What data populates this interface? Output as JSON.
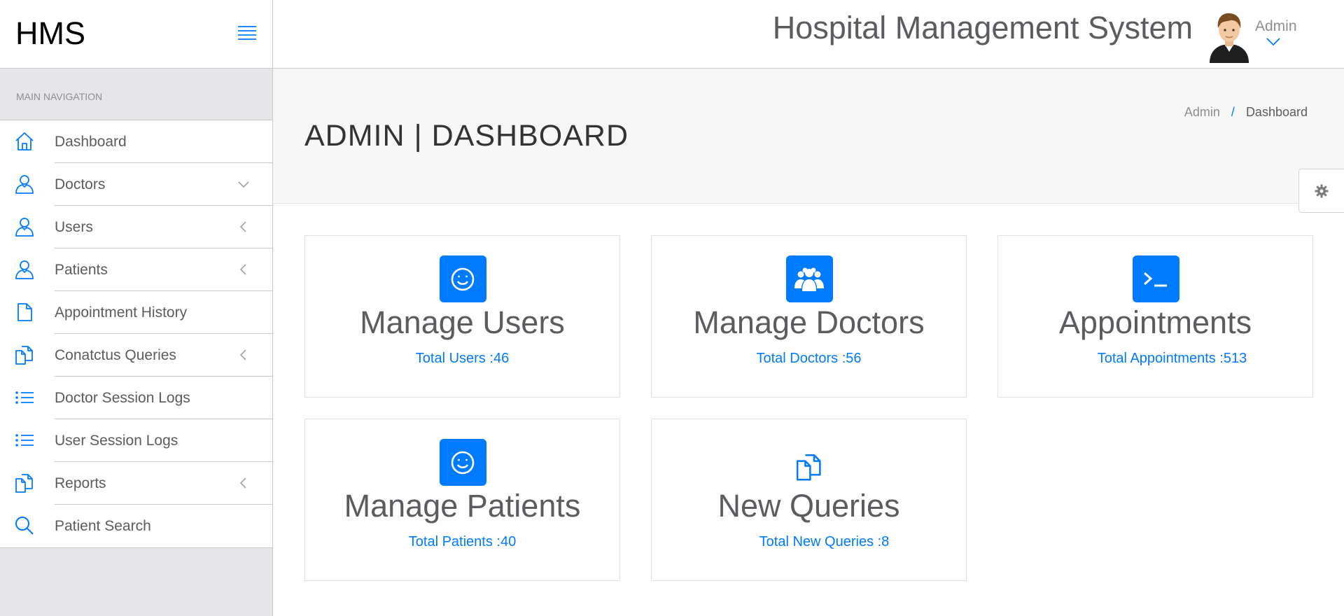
{
  "brand": "HMS",
  "nav_title": "MAIN NAVIGATION",
  "nav_items": [
    {
      "label": "Dashboard",
      "icon": "home-icon",
      "caret": ""
    },
    {
      "label": "Doctors",
      "icon": "user-icon",
      "caret": "chevron-down-icon"
    },
    {
      "label": "Users",
      "icon": "user-icon",
      "caret": "chevron-left-icon"
    },
    {
      "label": "Patients",
      "icon": "user-icon",
      "caret": "chevron-left-icon"
    },
    {
      "label": "Appointment History",
      "icon": "file-icon",
      "caret": ""
    },
    {
      "label": "Conatctus Queries",
      "icon": "files-icon",
      "caret": "chevron-left-icon"
    },
    {
      "label": "Doctor Session Logs",
      "icon": "list-icon",
      "caret": ""
    },
    {
      "label": "User Session Logs",
      "icon": "list-icon",
      "caret": ""
    },
    {
      "label": "Reports",
      "icon": "files-icon",
      "caret": "chevron-left-icon"
    },
    {
      "label": "Patient Search",
      "icon": "search-icon",
      "caret": ""
    }
  ],
  "header": {
    "title": "Hospital Management System",
    "user_name": "Admin"
  },
  "page": {
    "title": "ADMIN | DASHBOARD",
    "breadcrumb": [
      "Admin",
      "Dashboard"
    ],
    "breadcrumb_separator": "/"
  },
  "cards": [
    {
      "title": "Manage Users",
      "link": "Total Users :46",
      "icon": "smile-icon"
    },
    {
      "title": "Manage Doctors",
      "link": "Total Doctors :56",
      "icon": "users-group-icon"
    },
    {
      "title": "Appointments",
      "link": "Total Appointments :513",
      "icon": "terminal-icon"
    },
    {
      "title": "Manage Patients",
      "link": "Total Patients :40",
      "icon": "smile-icon"
    },
    {
      "title": "New Queries",
      "link": "Total New Queries :8",
      "icon": "files-icon"
    }
  ],
  "colors": {
    "accent": "#007aff",
    "sidebar_bg": "#e6e6e9",
    "text": "#5b5b60",
    "page_header_bg": "#f7f7f8"
  }
}
